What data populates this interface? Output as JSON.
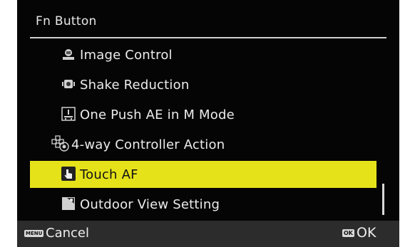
{
  "header": {
    "title": "Fn Button"
  },
  "menu": {
    "items": [
      {
        "label": "Image Control",
        "icon": "image-control-icon",
        "selected": false
      },
      {
        "label": "Shake Reduction",
        "icon": "shake-reduction-icon",
        "selected": false
      },
      {
        "label": "One Push AE in M Mode",
        "icon": "one-push-ae-icon",
        "selected": false
      },
      {
        "label": "4-way Controller Action",
        "icon": "four-way-controller-icon",
        "selected": false
      },
      {
        "label": "Touch AF",
        "icon": "touch-icon",
        "selected": true
      },
      {
        "label": "Outdoor View Setting",
        "icon": "outdoor-view-icon",
        "selected": false
      }
    ]
  },
  "footer": {
    "menu_key": "MENU",
    "cancel_label": "Cancel",
    "ok_key": "OK",
    "ok_label": "OK"
  },
  "colors": {
    "background": "#050505",
    "highlight": "#e5e21a",
    "footer": "#2c2c2c",
    "text": "#ececec"
  }
}
